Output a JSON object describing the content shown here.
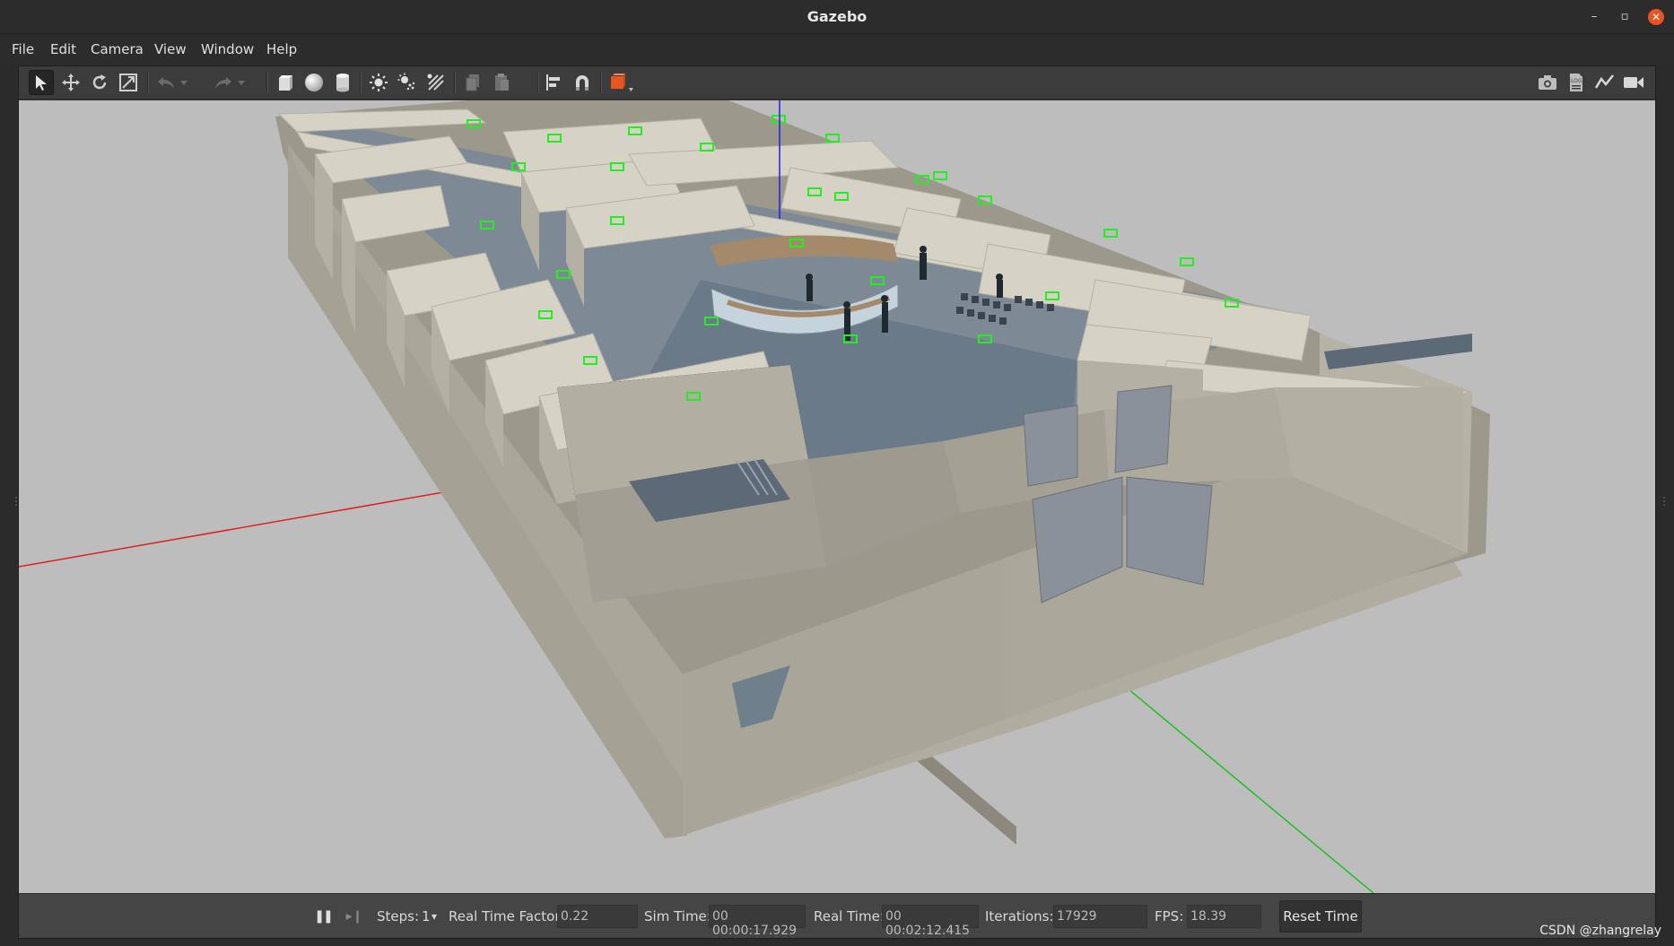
{
  "window": {
    "title": "Gazebo",
    "minimize_glyph": "–",
    "restore_glyph": "▫",
    "close_glyph": "✕"
  },
  "menu": [
    "File",
    "Edit",
    "Camera",
    "View",
    "Window",
    "Help"
  ],
  "toolbar": {
    "left_tools": [
      "select-arrow-icon",
      "translate-icon",
      "rotate-icon",
      "scale-icon",
      "undo-icon",
      "undo-history-icon",
      "redo-icon",
      "redo-history-icon",
      "box-shape-icon",
      "sphere-shape-icon",
      "cylinder-shape-icon",
      "point-light-icon",
      "spot-light-icon",
      "directional-light-icon",
      "copy-icon",
      "paste-icon",
      "align-icon",
      "snap-icon",
      "view-angle-icon"
    ],
    "right_tools": [
      "screenshot-icon",
      "log-icon",
      "plot-icon",
      "record-video-icon"
    ]
  },
  "status": {
    "pause_glyph": "❚❚",
    "step_glyph": "▸❙",
    "steps_label": "Steps:",
    "steps_value": "1",
    "steps_dropdown_glyph": "▾",
    "rtf_label": "Real Time Factor:",
    "rtf_value": "0.22",
    "sim_time_label": "Sim Time:",
    "sim_time_value": "00 00:00:17.929",
    "real_time_label": "Real Time:",
    "real_time_value": "00 00:02:12.415",
    "iterations_label": "Iterations:",
    "iterations_value": "17929",
    "fps_label": "FPS:",
    "fps_value": "18.39",
    "reset_label": "Reset Time"
  },
  "watermark": "CSDN @zhangrelay",
  "colors": {
    "accent": "#e95420",
    "viewport_bg": "#bdbdbd",
    "x_axis": "#e02020",
    "y_axis": "#20c020",
    "z_axis": "#2020e0",
    "marker": "#22ee22",
    "wall": "#a6a297",
    "floor": "#6f7f8c"
  }
}
